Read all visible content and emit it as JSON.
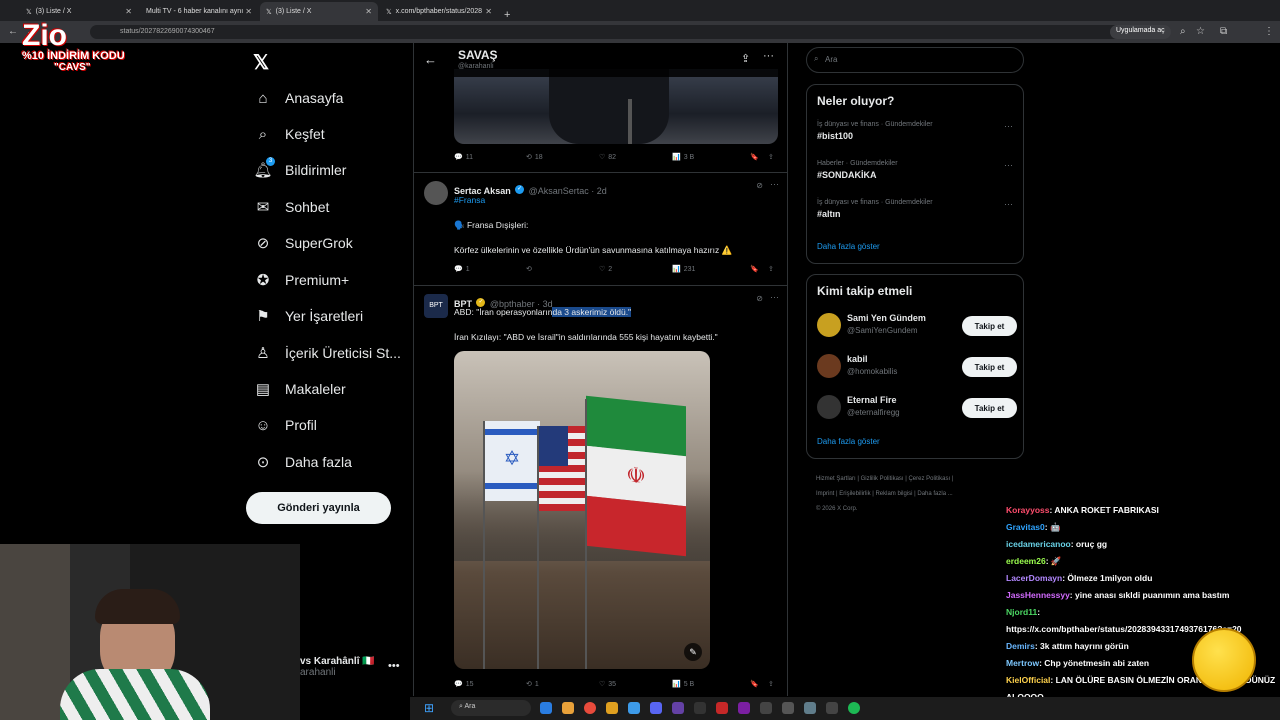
{
  "browser": {
    "tabs": [
      {
        "label": "(3) Liste / X",
        "active": false
      },
      {
        "label": "Multi TV - 6 haber kanalını aynı",
        "active": false
      },
      {
        "label": "(3) Liste / X",
        "active": true
      },
      {
        "label": "x.com/bpthaber/status/2028",
        "active": false
      }
    ],
    "url": "status/2027822690074300467",
    "open_app_label": "Uygulamada aç"
  },
  "promo": {
    "line1": "%10 İNDİRİM KODU",
    "line2": "\"CAVS\""
  },
  "sidebar": {
    "items": [
      {
        "label": "Anasayfa",
        "icon": "home-icon"
      },
      {
        "label": "Keşfet",
        "icon": "search-icon"
      },
      {
        "label": "Bildirimler",
        "icon": "bell-icon",
        "badge": "3"
      },
      {
        "label": "Sohbet",
        "icon": "mail-icon"
      },
      {
        "label": "SuperGrok",
        "icon": "grok-icon"
      },
      {
        "label": "Premium+",
        "icon": "premium-icon"
      },
      {
        "label": "Yer İşaretleri",
        "icon": "bookmark-icon"
      },
      {
        "label": "İçerik Üreticisi St...",
        "icon": "creator-icon"
      },
      {
        "label": "Makaleler",
        "icon": "article-icon"
      },
      {
        "label": "Profil",
        "icon": "profile-icon"
      },
      {
        "label": "Daha fazla",
        "icon": "more-icon"
      }
    ],
    "post_button": "Gönderi yayınla",
    "account_name": "vs Karahânlî 🇮🇹",
    "account_handle": "arahanli"
  },
  "header": {
    "title": "SAVAŞ",
    "handle": "@karahanli"
  },
  "tweets": [
    {
      "actions": {
        "reply": "11",
        "retweet": "18",
        "like": "82",
        "views": "3 B"
      }
    },
    {
      "name": "Sertac Aksan",
      "handle": "@AksanSertac · 2d",
      "hashtag": "#Fransa",
      "line1": "🗣️ Fransa Dışişleri:",
      "line2": "Körfez ülkelerinin ve özellikle Ürdün'ün savunmasına katılmaya hazırız ⚠️",
      "actions": {
        "reply": "1",
        "retweet": "",
        "like": "2",
        "views": "231"
      }
    },
    {
      "name": "BPT",
      "handle": "@bpthaber · 3d",
      "line1_a": "ABD: \"İran operasyonların",
      "line1_b": "da 3 askerimiz öldü.\"",
      "line2": "İran Kızılayı: \"ABD ve İsrail\"in saldırılarında 555 kişi hayatını kaybetti.\"",
      "actions": {
        "reply": "15",
        "retweet": "1",
        "like": "35",
        "views": "5 B"
      }
    }
  ],
  "right": {
    "search_placeholder": "Ara",
    "trends_title": "Neler oluyor?",
    "trends": [
      {
        "meta": "İş dünyası ve finans · Gündemdekiler",
        "name": "#bist100"
      },
      {
        "meta": "Haberler · Gündemdekiler",
        "name": "#SONDAKİKA"
      },
      {
        "meta": "İş dünyası ve finans · Gündemdekiler",
        "name": "#altın"
      }
    ],
    "show_more": "Daha fazla göster",
    "follow_title": "Kimi takip etmeli",
    "follow": [
      {
        "name": "Sami Yen Gündem",
        "handle": "@SamiYenGundem",
        "button": "Takip et"
      },
      {
        "name": "kabil",
        "handle": "@homokabilis",
        "button": "Takip et"
      },
      {
        "name": "Eternal Fire",
        "handle": "@eternalfiregg",
        "button": "Takip et"
      }
    ],
    "footer_line1": "Hizmet Şartları | Gizlilik Politikası | Çerez Politikası |",
    "footer_line2": "Imprint | Erişilebilirlik | Reklam bilgisi | Daha fazla ...",
    "footer_line3": "© 2026 X Corp."
  },
  "chat": [
    {
      "user": "Korayyoss",
      "color": "#ff4d6d",
      "msg": ": ANKA ROKET FABRIKASI"
    },
    {
      "user": "Gravitas0",
      "color": "#2fa4ff",
      "msg": ": 🤖"
    },
    {
      "user": "icedamericanoo",
      "color": "#69d2e7",
      "msg": ": oruç gg"
    },
    {
      "user": "erdeem26",
      "color": "#9cff4f",
      "msg": ": 🚀"
    },
    {
      "user": "LacerDomayn",
      "color": "#b388ff",
      "msg": ": Ölmeze 1milyon oldu"
    },
    {
      "user": "JassHennessyy",
      "color": "#d36bff",
      "msg": ": yine anası sıkldi puanımın ama bastım"
    },
    {
      "user": "Njord11",
      "color": "#4cd964",
      "msg": ":"
    },
    {
      "user": "",
      "color": "#fff",
      "msg": "https://x.com/bpthaber/status/2028394331749376176?s=20"
    },
    {
      "user": "Demirs",
      "color": "#69b7ff",
      "msg": ": 3k attım hayrını görün"
    },
    {
      "user": "Mertrow",
      "color": "#7ec8ff",
      "msg": ": Chp yönetmesin abi zaten"
    },
    {
      "user": "KielOfficial",
      "color": "#ffd24d",
      "msg": ": LAN ÖLÜRE BASIN ÖLMEZİN ORANINI DÜŞÜRDÜNÜZ ALOOOO"
    }
  ],
  "taskbar": {
    "search": "Ara"
  }
}
